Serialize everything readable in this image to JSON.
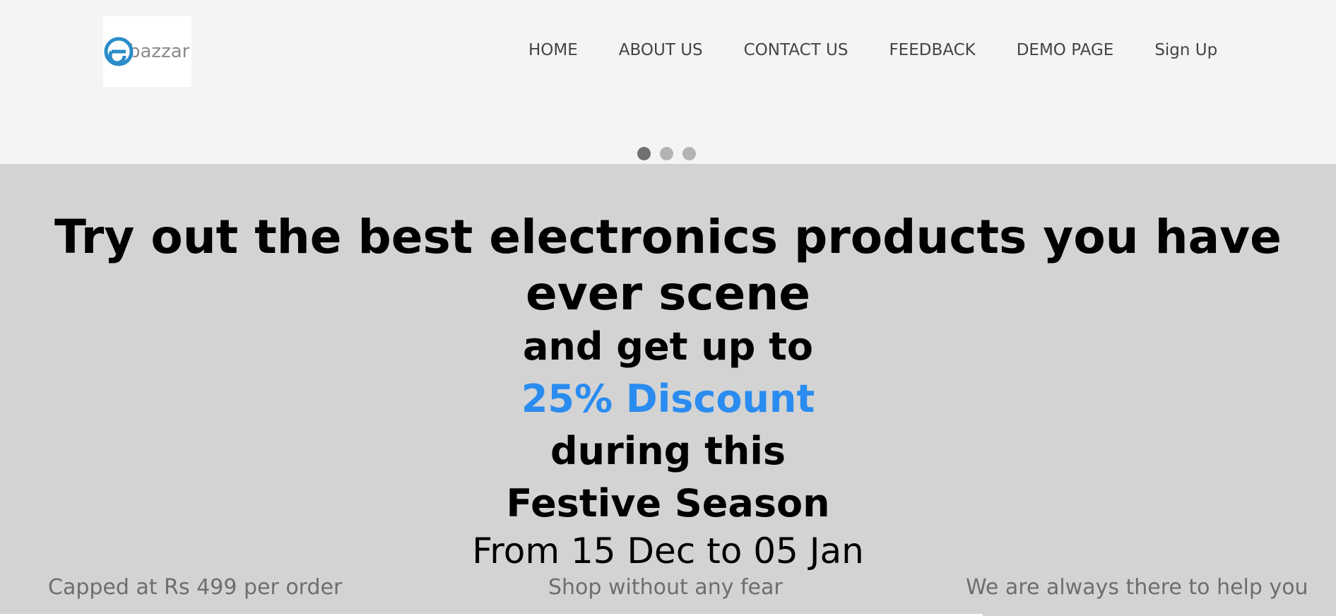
{
  "logo": {
    "icon": "ebazzar-e-icon",
    "text": "bazzar",
    "accent": "#2a8cc8"
  },
  "nav": {
    "items": [
      {
        "label": "HOME"
      },
      {
        "label": "ABOUT US"
      },
      {
        "label": "CONTACT US"
      },
      {
        "label": "FEEDBACK"
      },
      {
        "label": "DEMO PAGE"
      },
      {
        "label": "Sign Up"
      }
    ]
  },
  "carousel": {
    "slide_count": 3,
    "active_index": 0
  },
  "hero": {
    "headline": "Try out the best electronics products you have ever scene",
    "line2": "and get up to",
    "discount": "25% Discount",
    "line4": "during this",
    "line5": "Festive Season",
    "dates": "From 15 Dec to 05 Jan",
    "accent_color": "#2a8cf0"
  },
  "taglines": [
    "Capped at Rs 499 per order",
    "Shop without any fear",
    "We are always there to help you"
  ]
}
